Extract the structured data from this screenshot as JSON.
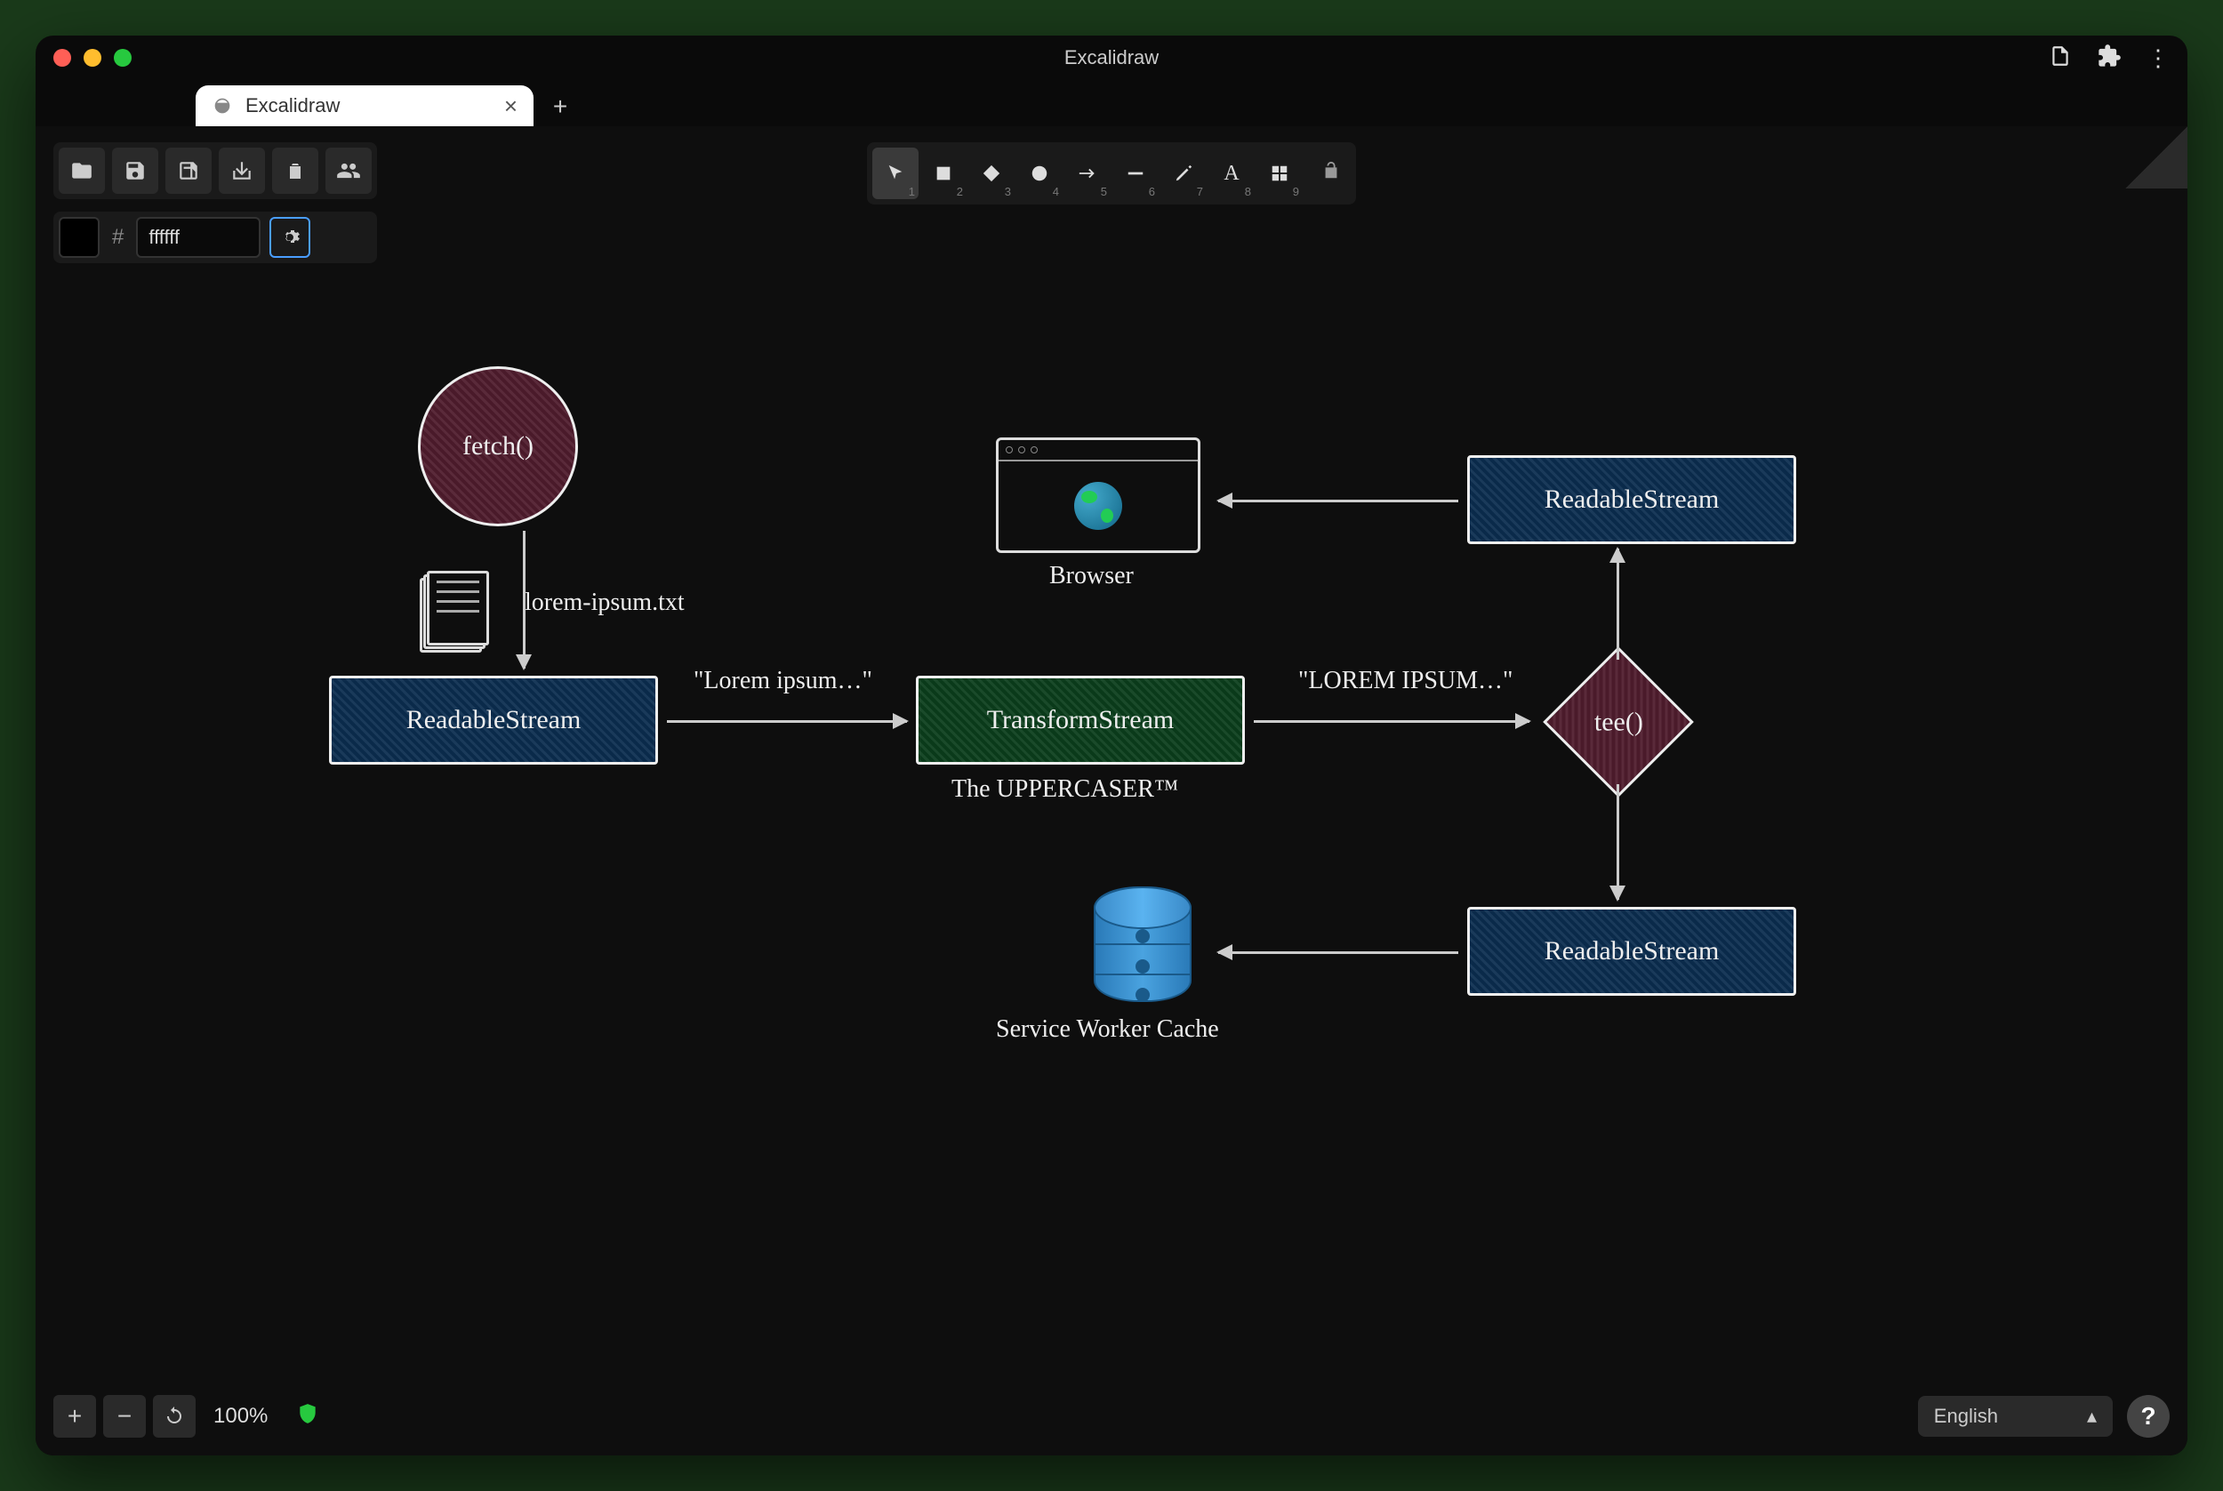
{
  "window": {
    "title": "Excalidraw",
    "tab_title": "Excalidraw"
  },
  "color": {
    "value": "ffffff"
  },
  "tools": {
    "n1": "1",
    "n2": "2",
    "n3": "3",
    "n4": "4",
    "n5": "5",
    "n6": "6",
    "n7": "7",
    "n8": "8",
    "n9": "9"
  },
  "zoom": {
    "value": "100%"
  },
  "lang": {
    "selected": "English"
  },
  "diagram": {
    "fetch": "fetch()",
    "file_label": "lorem-ipsum.txt",
    "readable1": "ReadableStream",
    "edge1": "\"Lorem ipsum…\"",
    "transform": "TransformStream",
    "transform_sub": "The UPPERCASER™",
    "edge2": "\"LOREM IPSUM…\"",
    "tee": "tee()",
    "readable2": "ReadableStream",
    "readable3": "ReadableStream",
    "browser_label": "Browser",
    "cache_label": "Service Worker Cache"
  }
}
